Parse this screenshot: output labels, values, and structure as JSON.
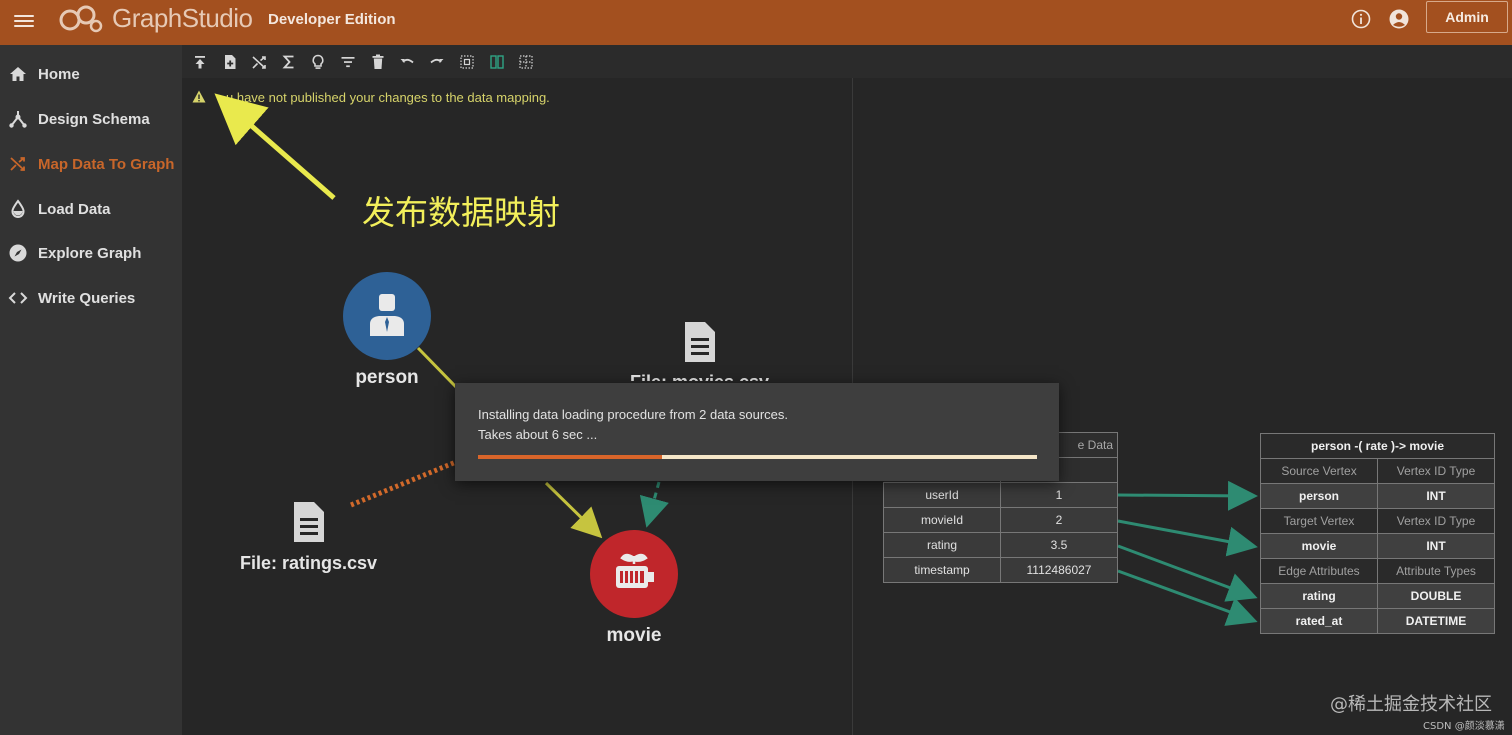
{
  "header": {
    "brand": "GraphStudio",
    "edition": "Developer Edition",
    "admin_label": "Admin"
  },
  "sidebar": {
    "items": [
      {
        "label": "Home",
        "icon": "home-icon"
      },
      {
        "label": "Design Schema",
        "icon": "schema-icon"
      },
      {
        "label": "Map Data To Graph",
        "icon": "shuffle-icon",
        "active": true
      },
      {
        "label": "Load Data",
        "icon": "drop-icon"
      },
      {
        "label": "Explore Graph",
        "icon": "compass-icon"
      },
      {
        "label": "Write Queries",
        "icon": "code-icon"
      }
    ]
  },
  "toolbar": {
    "icons": [
      "publish-icon",
      "add-file-icon",
      "map-icon",
      "sum-icon",
      "bulb-icon",
      "filter-icon",
      "delete-icon",
      "undo-icon",
      "redo-icon",
      "select-grid-icon",
      "split-view-icon",
      "grid-off-icon"
    ]
  },
  "warning": {
    "text": "u have not published your changes to the data mapping."
  },
  "annotation": {
    "text": "发布数据映射"
  },
  "canvas": {
    "nodes": {
      "person": "person",
      "movie": "movie"
    },
    "files": {
      "ratings": "File: ratings.csv",
      "movies": "File: movies.csv"
    }
  },
  "dialog": {
    "line1": "Installing data loading procedure from 2 data sources.",
    "line2": "Takes about 6 sec ...",
    "progress": 0.33
  },
  "source_table": {
    "header_right": "e Data",
    "rows": [
      {
        "name": "userId",
        "value": "1"
      },
      {
        "name": "movieId",
        "value": "2"
      },
      {
        "name": "rating",
        "value": "3.5"
      },
      {
        "name": "timestamp",
        "value": "1112486027"
      }
    ]
  },
  "edge_table": {
    "title": "person -( rate )-> movie",
    "rows": [
      {
        "kind": "sub",
        "left": "Source Vertex",
        "right": "Vertex ID Type"
      },
      {
        "kind": "val",
        "left": "person",
        "right": "INT"
      },
      {
        "kind": "sub",
        "left": "Target Vertex",
        "right": "Vertex ID Type"
      },
      {
        "kind": "val",
        "left": "movie",
        "right": "INT"
      },
      {
        "kind": "sub",
        "left": "Edge Attributes",
        "right": "Attribute Types"
      },
      {
        "kind": "val",
        "left": "rating",
        "right": "DOUBLE"
      },
      {
        "kind": "val",
        "left": "rated_at",
        "right": "DATETIME"
      }
    ]
  },
  "watermark": {
    "main": "@稀土掘金技术社区",
    "csdn": "CSDN @颜淡慕潇"
  },
  "colors": {
    "header_bg": "#a3501f",
    "accent": "#c8662a",
    "arrow_yellow": "#e9e94d",
    "mapping_teal": "#2e8b72"
  }
}
